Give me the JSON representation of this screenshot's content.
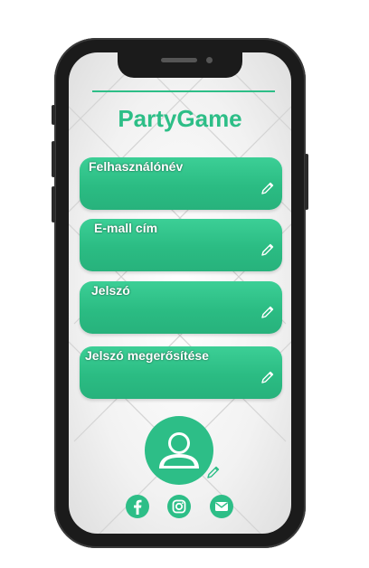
{
  "app": {
    "title": "PartyGame"
  },
  "form": {
    "fields": [
      {
        "label": "Felhasználónév"
      },
      {
        "label": "E-mall cím"
      },
      {
        "label": "Jelszó"
      },
      {
        "label": "Jelszó megerősítése"
      }
    ]
  },
  "profile": {
    "avatar_icon": "user-icon",
    "edit_icon": "pencil-icon"
  },
  "social": [
    "facebook-icon",
    "instagram-icon",
    "mail-icon"
  ],
  "colors": {
    "accent": "#2dbe87",
    "field_text": "#ffffff"
  }
}
